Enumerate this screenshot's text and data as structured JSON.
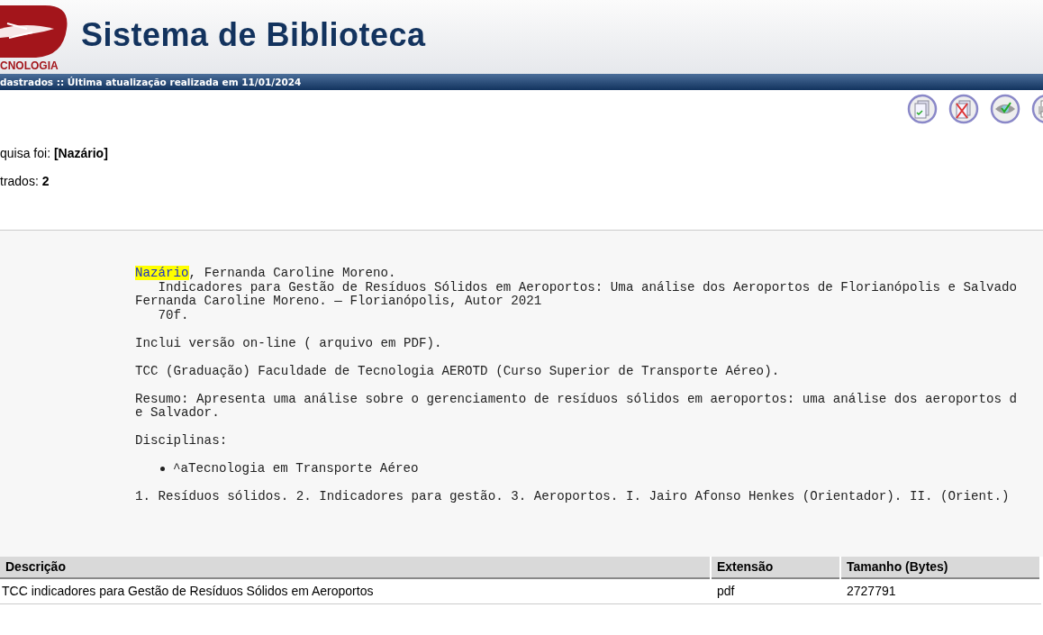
{
  "header": {
    "logo_text": "CNOLOGIA",
    "title": "Sistema de Biblioteca"
  },
  "status_bar": "dastrados :: Última atualização realizada em 11/01/2024",
  "search": {
    "label": "quisa foi: ",
    "term": "[Nazário]",
    "count_label": "trados: ",
    "count": "2"
  },
  "record": {
    "highlight": "Nazário",
    "author_rest": ", Fernanda Caroline Moreno.",
    "blocks": [
      [
        "   Indicadores para Gestão de Resíduos Sólidos em Aeroportos: Uma análise dos Aeroportos de Florianópolis e Salvado",
        "Fernanda Caroline Moreno. — Florianópolis, Autor 2021",
        "   70f."
      ],
      [
        "Inclui versão on-line ( arquivo em PDF)."
      ],
      [
        "TCC (Graduação) Faculdade de Tecnologia AEROTD (Curso Superior de Transporte Aéreo)."
      ],
      [
        "Resumo: Apresenta uma análise sobre o gerenciamento de resíduos sólidos em aeroportos: uma análise dos aeroportos d",
        "e Salvador."
      ],
      [
        "Disciplinas:"
      ]
    ],
    "disciplines": [
      "^aTecnologia em Transporte Aéreo"
    ],
    "subjects": "1. Resíduos sólidos. 2. Indicadores para gestão. 3. Aeroportos. I. Jairo Afonso Henkes (Orientador). II. (Orient.)"
  },
  "table": {
    "columns": [
      "Descrição",
      "Extensão",
      "Tamanho (Bytes)"
    ],
    "rows": [
      [
        "TCC indicadores para Gestão de Resíduos Sólidos em Aeroportos",
        "pdf",
        "2727791"
      ]
    ]
  }
}
